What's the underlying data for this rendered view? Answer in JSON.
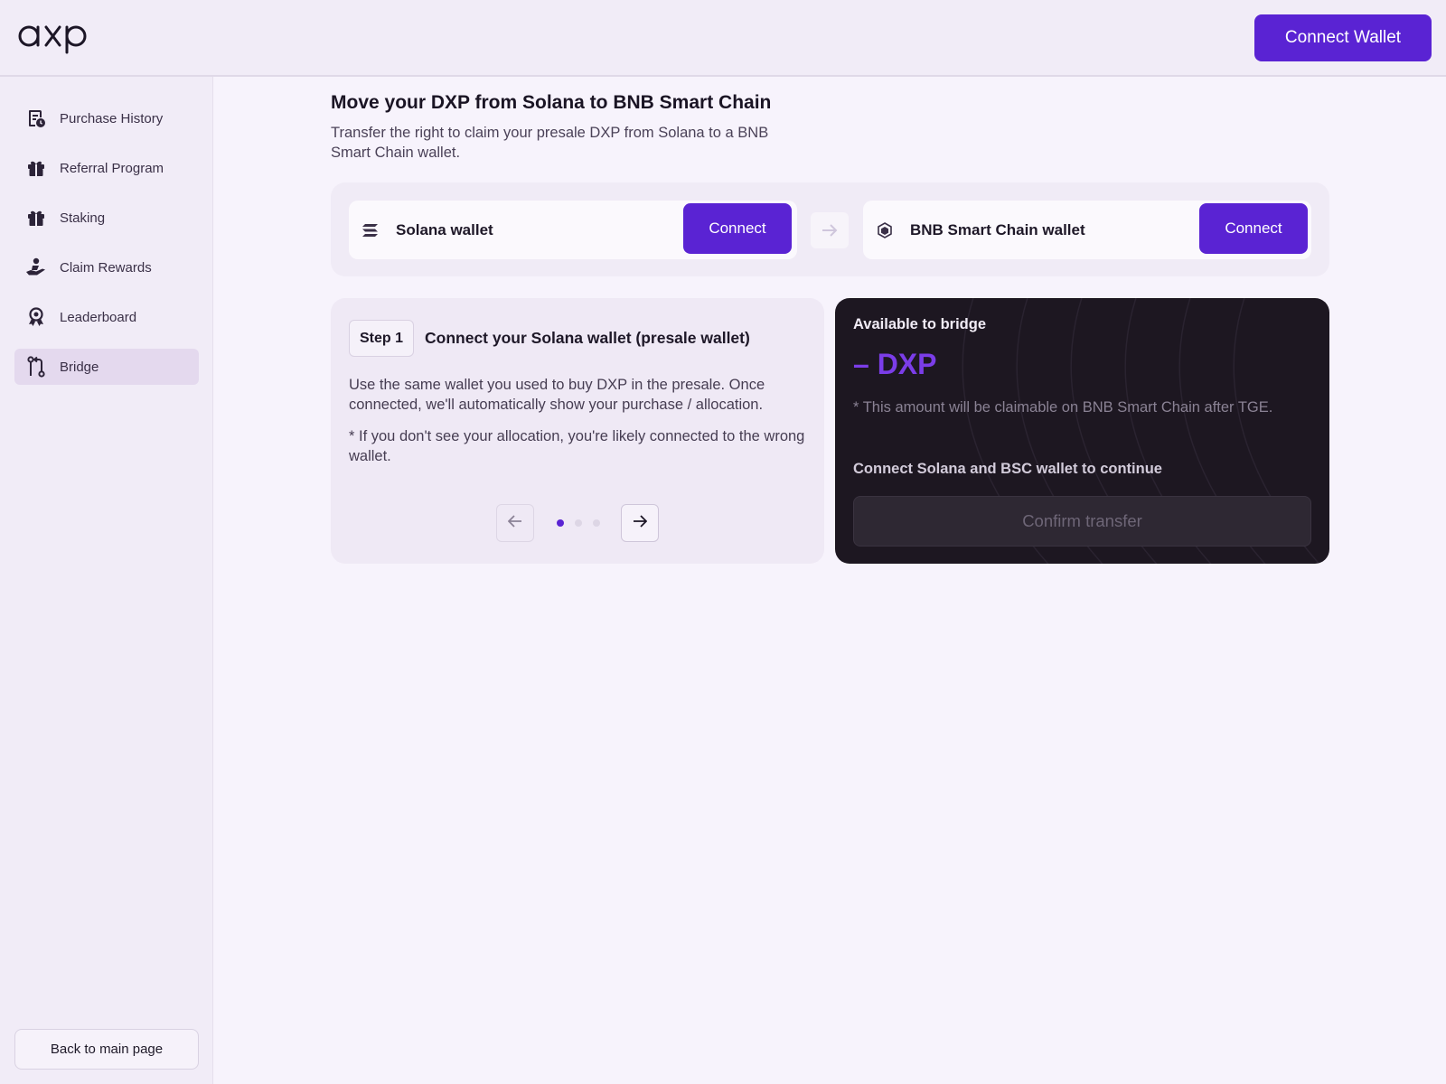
{
  "header": {
    "logo_text": "dxp",
    "connect_wallet_label": "Connect Wallet"
  },
  "sidebar": {
    "items": [
      {
        "label": "Purchase History",
        "icon": "receipt-clock-icon",
        "active": false
      },
      {
        "label": "Referral Program",
        "icon": "gift-icon",
        "active": false
      },
      {
        "label": "Staking",
        "icon": "gift-icon",
        "active": false
      },
      {
        "label": "Claim Rewards",
        "icon": "hand-coin-icon",
        "active": false
      },
      {
        "label": "Leaderboard",
        "icon": "award-badge-icon",
        "active": false
      },
      {
        "label": "Bridge",
        "icon": "bridge-icon",
        "active": true
      }
    ],
    "back_label": "Back to main page"
  },
  "main": {
    "title": "Move your DXP from Solana to BNB Smart Chain",
    "subtitle": "Transfer the right to claim your presale DXP from Solana to a BNB Smart Chain wallet.",
    "wallets": {
      "solana": {
        "label": "Solana wallet",
        "icon": "solana-icon",
        "button": "Connect"
      },
      "bnb": {
        "label": "BNB Smart Chain wallet",
        "icon": "bnb-icon",
        "button": "Connect"
      }
    },
    "step": {
      "badge": "Step 1",
      "title": "Connect your Solana wallet (presale wallet)",
      "description": "Use the same wallet you used to buy DXP in the presale. Once connected, we'll automatically show your purchase / allocation.",
      "note": "* If you don't see your allocation, you're likely connected to the wrong wallet.",
      "current_page": 1,
      "total_pages": 3
    },
    "bridge": {
      "available_label": "Available to bridge",
      "amount": "– DXP",
      "claim_note": "* This amount will be claimable on BNB Smart Chain after TGE.",
      "continue_text": "Connect Solana and BSC wallet to continue",
      "confirm_label": "Confirm transfer"
    }
  },
  "colors": {
    "accent": "#5a23d3",
    "amount": "#7b3de8",
    "dark_card": "#1d1721",
    "active_nav": "#e4d9ee"
  }
}
